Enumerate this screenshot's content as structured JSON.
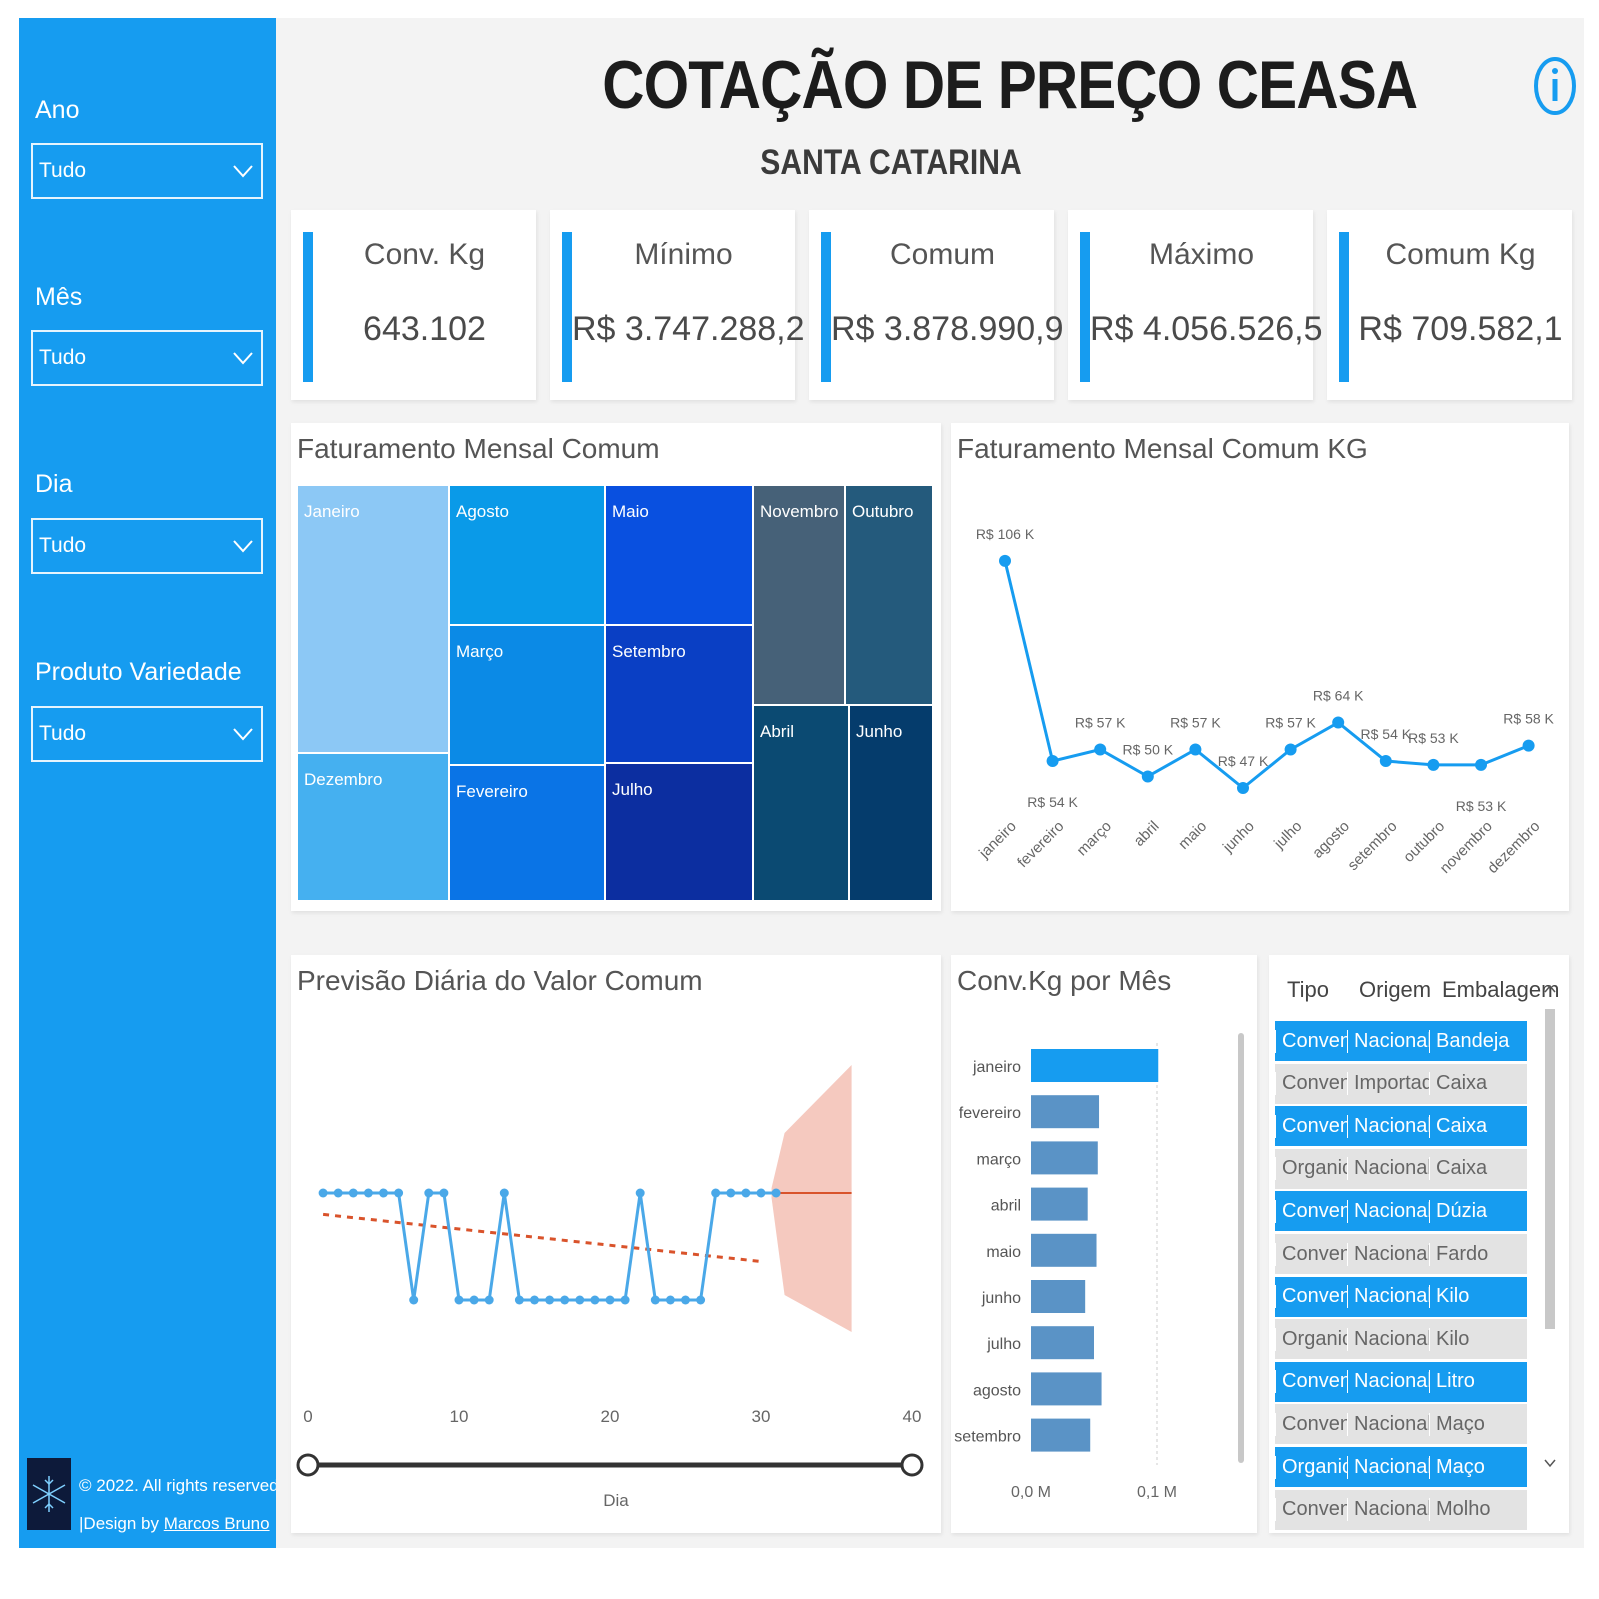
{
  "sidebar": {
    "filters": [
      {
        "label": "Ano",
        "value": "Tudo"
      },
      {
        "label": "Mês",
        "value": "Tudo"
      },
      {
        "label": "Dia",
        "value": "Tudo"
      },
      {
        "label": "Produto Variedade",
        "value": "Tudo"
      }
    ],
    "footer": {
      "copyright": "© 2022. All rights reserved",
      "design_prefix": "|Design by ",
      "designer": "Marcos Bruno"
    }
  },
  "header": {
    "title": "COTAÇÃO DE PREÇO CEASA",
    "subtitle": "SANTA CATARINA",
    "info_icon": "info-icon"
  },
  "kpis": [
    {
      "label": "Conv. Kg",
      "value": "643.102"
    },
    {
      "label": "Mínimo",
      "value": "R$ 3.747.288,2"
    },
    {
      "label": "Comum",
      "value": "R$ 3.878.990,9"
    },
    {
      "label": "Máximo",
      "value": "R$ 4.056.526,5"
    },
    {
      "label": "Comum Kg",
      "value": "R$ 709.582,1"
    }
  ],
  "colors": {
    "accent": "#169cf0",
    "forecast_band": "#f5c9bf",
    "trend": "#d9532b"
  },
  "treemap": {
    "title": "Faturamento Mensal Comum",
    "cells": [
      {
        "label": "Janeiro",
        "color": "#8cc8f5"
      },
      {
        "label": "Dezembro",
        "color": "#45b0f0"
      },
      {
        "label": "Agosto",
        "color": "#0a9ae8"
      },
      {
        "label": "Março",
        "color": "#0b8ae6"
      },
      {
        "label": "Fevereiro",
        "color": "#0a74e6"
      },
      {
        "label": "Maio",
        "color": "#0950e0"
      },
      {
        "label": "Setembro",
        "color": "#0a3fc4"
      },
      {
        "label": "Julho",
        "color": "#0c2ea0"
      },
      {
        "label": "Novembro",
        "color": "#466178"
      },
      {
        "label": "Outubro",
        "color": "#245a7c"
      },
      {
        "label": "Abril",
        "color": "#0b4a72"
      },
      {
        "label": "Junho",
        "color": "#053c6c"
      }
    ]
  },
  "line_chart": {
    "title": "Faturamento Mensal Comum KG",
    "chart_data": {
      "type": "line",
      "categories": [
        "janeiro",
        "fevereiro",
        "março",
        "abril",
        "maio",
        "junho",
        "julho",
        "agosto",
        "setembro",
        "outubro",
        "novembro",
        "dezembro"
      ],
      "values": [
        106,
        54,
        57,
        50,
        57,
        47,
        57,
        64,
        54,
        53,
        53,
        58
      ],
      "labels": [
        "R$ 106 K",
        "R$ 54 K",
        "R$ 57 K",
        "R$ 50 K",
        "R$ 57 K",
        "R$ 47 K",
        "R$ 57 K",
        "R$ 64 K",
        "R$ 54 K",
        "R$ 53 K",
        "R$ 53 K",
        "R$ 58 K"
      ],
      "unit": "R$ K"
    }
  },
  "forecast_chart": {
    "title": "Previsão Diária do Valor Comum",
    "xlabel": "Dia",
    "xticks": [
      "0",
      "10",
      "20",
      "30",
      "40"
    ],
    "chart_data": {
      "type": "line",
      "x_range": [
        0,
        40
      ],
      "series": [
        {
          "values": [
            1,
            1,
            1,
            1,
            1,
            1,
            0,
            1,
            1,
            0,
            0,
            0,
            1,
            0,
            0,
            0,
            0,
            0,
            0,
            0,
            0,
            1,
            0,
            0,
            0,
            0,
            1,
            1,
            1,
            1,
            1
          ]
        }
      ],
      "trend_start": 0.8,
      "trend_end": 0.36,
      "forecast_start": 31,
      "forecast_end": 36,
      "forecast_value": 1
    }
  },
  "bar_chart": {
    "title": "Conv.Kg por Mês",
    "xticks": [
      "0,0 M",
      "0,1 M"
    ],
    "chart_data": {
      "type": "bar",
      "orientation": "horizontal",
      "categories": [
        "janeiro",
        "fevereiro",
        "março",
        "abril",
        "maio",
        "junho",
        "julho",
        "agosto",
        "setembro"
      ],
      "values": [
        0.101,
        0.054,
        0.053,
        0.045,
        0.052,
        0.043,
        0.05,
        0.056,
        0.047
      ],
      "xlim": [
        0,
        0.1
      ],
      "highlight": "janeiro"
    }
  },
  "table": {
    "headers": [
      "Tipo",
      "Origem",
      "Embalagem"
    ],
    "rows": [
      {
        "tipo": "Convenci",
        "origem": "Nacional",
        "embalagem": "Bandeja",
        "selected": true
      },
      {
        "tipo": "Convenci",
        "origem": "Importado",
        "embalagem": "Caixa",
        "selected": false
      },
      {
        "tipo": "Convenci",
        "origem": "Nacional",
        "embalagem": "Caixa",
        "selected": true
      },
      {
        "tipo": "Organico",
        "origem": "Nacional",
        "embalagem": "Caixa",
        "selected": false
      },
      {
        "tipo": "Convenci",
        "origem": "Nacional",
        "embalagem": "Dúzia",
        "selected": true
      },
      {
        "tipo": "Convenci",
        "origem": "Nacional",
        "embalagem": "Fardo",
        "selected": false
      },
      {
        "tipo": "Convenci",
        "origem": "Nacional",
        "embalagem": "Kilo",
        "selected": true
      },
      {
        "tipo": "Organico",
        "origem": "Nacional",
        "embalagem": "Kilo",
        "selected": false
      },
      {
        "tipo": "Convenci",
        "origem": "Nacional",
        "embalagem": "Litro",
        "selected": true
      },
      {
        "tipo": "Convenci",
        "origem": "Nacional",
        "embalagem": "Maço",
        "selected": false
      },
      {
        "tipo": "Organico",
        "origem": "Nacional",
        "embalagem": "Maço",
        "selected": true
      },
      {
        "tipo": "Convenci",
        "origem": "Nacional",
        "embalagem": "Molho",
        "selected": false
      }
    ]
  }
}
